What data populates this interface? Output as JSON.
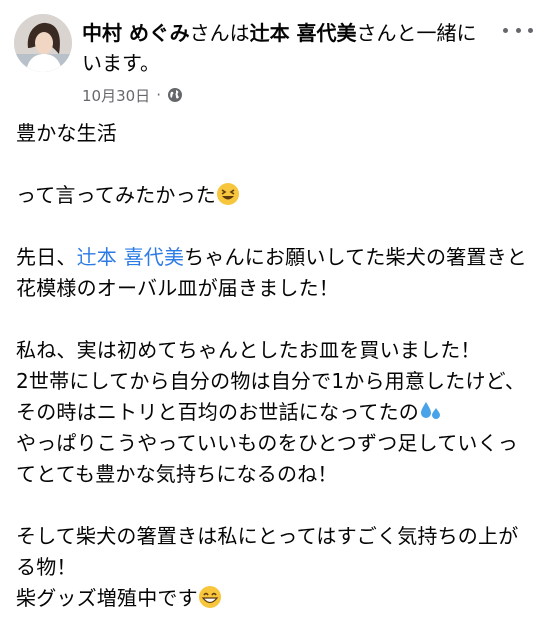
{
  "post": {
    "author": "中村 めぐみ",
    "connector1": "さんは",
    "tagged": "辻本 喜代美",
    "connector2": "さんと一緒にいます。",
    "date": "10月30日",
    "separator": "·",
    "privacy_icon": "globe-icon",
    "more_icon": "more-options-icon"
  },
  "body": {
    "line1": "豊かな生活",
    "line2": "って言ってみたかった",
    "p2_pre": "先日、",
    "p2_mention": "辻本 喜代美",
    "p2_post": "ちゃんにお願いしてた柴犬の箸置きと花模様のオーバル皿が届きました！",
    "p3_a": "私ね、実は初めてちゃんとしたお皿を買いました！",
    "p3_b": "2世帯にしてから自分の物は自分で1から用意したけど、その時はニトリと百均のお世話になってたの",
    "p3_c": "やっぱりこうやっていいものをひとつずつ足していくってとても豊かな気持ちになるのね！",
    "p4_a": "そして柴犬の箸置きは私にとってはすごく気持ちの上がる物！",
    "p4_b": "柴グッズ増殖中です"
  },
  "emoji": {
    "laugh": "grinning-squinting-face",
    "sweat": "sweat-droplets",
    "grin": "beaming-face"
  },
  "colors": {
    "mention": "#2d7be5",
    "secondary": "#65676b",
    "text": "#050505"
  }
}
